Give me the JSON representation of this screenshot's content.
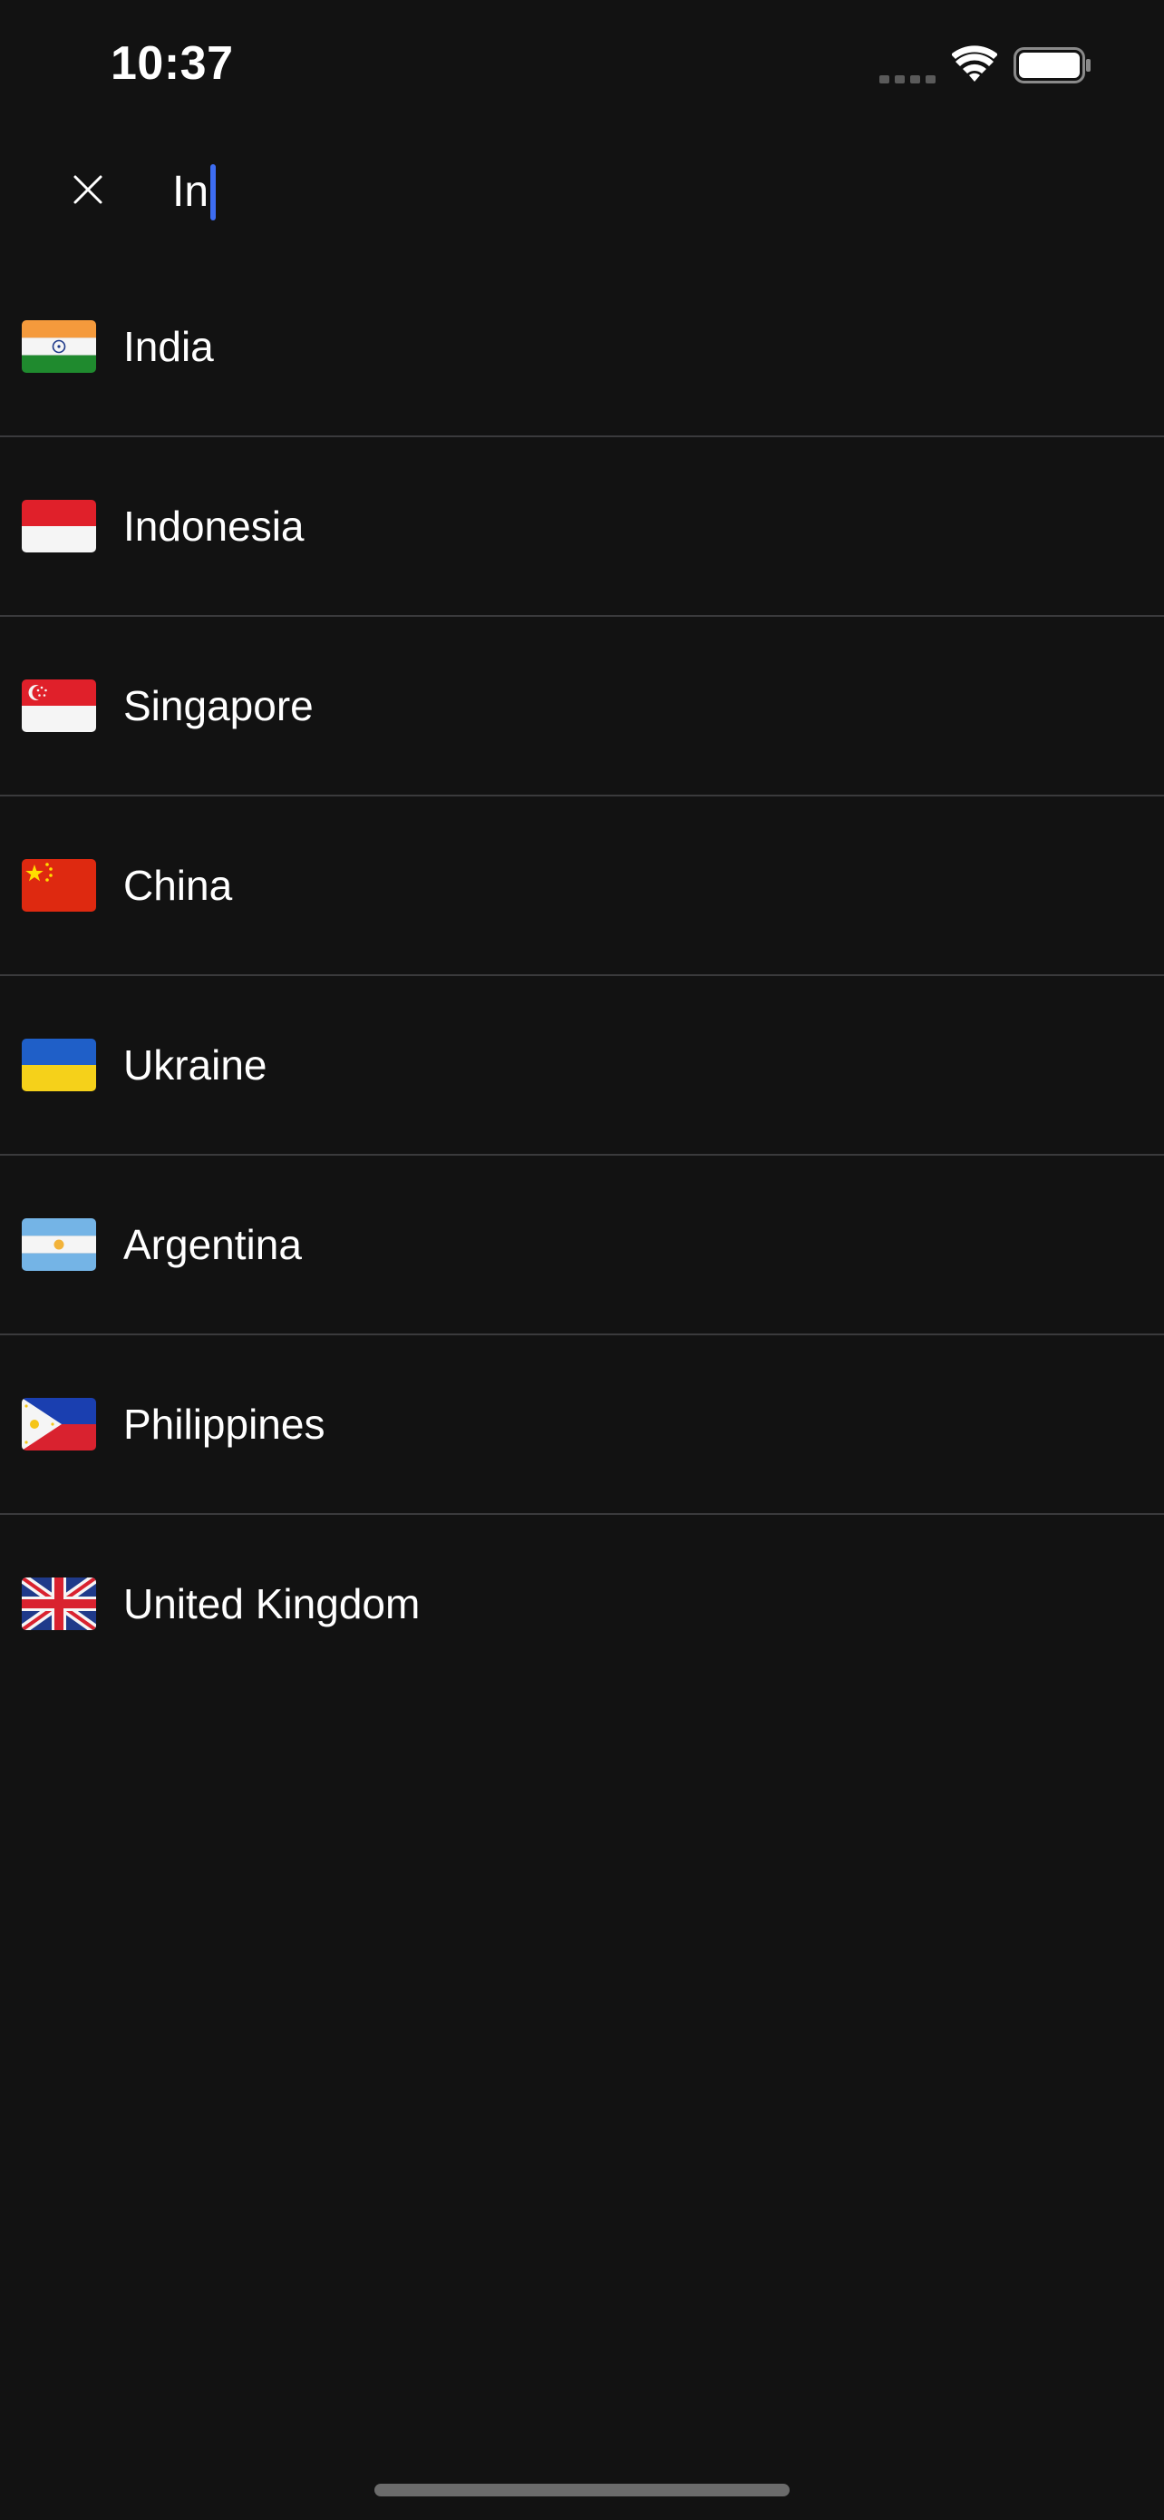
{
  "status_bar": {
    "time": "10:37",
    "icons": [
      "signal-dots-icon",
      "wifi-icon",
      "battery-icon"
    ]
  },
  "search": {
    "close_icon": "close-icon",
    "query": "In",
    "caret_color": "#3d6df2"
  },
  "countries": [
    {
      "name": "India",
      "flag": "flag-india-icon"
    },
    {
      "name": "Indonesia",
      "flag": "flag-indonesia-icon"
    },
    {
      "name": "Singapore",
      "flag": "flag-singapore-icon"
    },
    {
      "name": "China",
      "flag": "flag-china-icon"
    },
    {
      "name": "Ukraine",
      "flag": "flag-ukraine-icon"
    },
    {
      "name": "Argentina",
      "flag": "flag-argentina-icon"
    },
    {
      "name": "Philippines",
      "flag": "flag-philippines-icon"
    },
    {
      "name": "United Kingdom",
      "flag": "flag-united-kingdom-icon"
    }
  ],
  "theme": {
    "background": "#121212",
    "divider": "#3a3a3c",
    "text": "#ffffff"
  }
}
